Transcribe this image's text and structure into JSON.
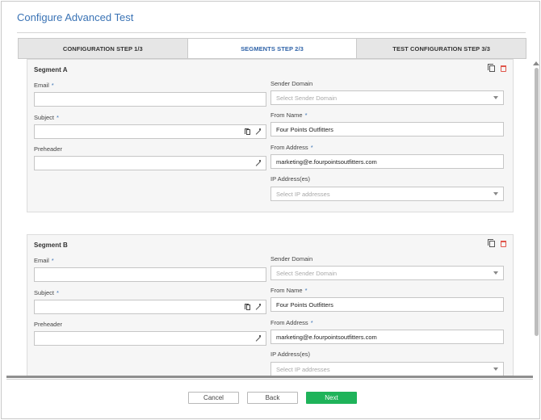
{
  "dialog": {
    "title": "Configure Advanced Test"
  },
  "tabs": [
    {
      "label": "CONFIGURATION STEP 1/3",
      "active": false
    },
    {
      "label": "SEGMENTS STEP 2/3",
      "active": true
    },
    {
      "label": "TEST CONFIGURATION STEP 3/3",
      "active": false
    }
  ],
  "segments": [
    {
      "title": "Segment A",
      "email": {
        "label": "Email",
        "required": "*",
        "value": ""
      },
      "subject": {
        "label": "Subject",
        "required": "*",
        "value": ""
      },
      "preheader": {
        "label": "Preheader",
        "value": ""
      },
      "sender_domain": {
        "label": "Sender Domain",
        "placeholder": "Select Sender Domain"
      },
      "from_name": {
        "label": "From Name",
        "required": "*",
        "value": "Four Points Outfitters"
      },
      "from_address": {
        "label": "From Address",
        "required": "*",
        "value": "marketing@e.fourpointsoutfitters.com"
      },
      "ip_addresses": {
        "label": "IP Address(es)",
        "placeholder": "Select IP addresses"
      }
    },
    {
      "title": "Segment B",
      "email": {
        "label": "Email",
        "required": "*",
        "value": ""
      },
      "subject": {
        "label": "Subject",
        "required": "*",
        "value": ""
      },
      "preheader": {
        "label": "Preheader",
        "value": ""
      },
      "sender_domain": {
        "label": "Sender Domain",
        "placeholder": "Select Sender Domain"
      },
      "from_name": {
        "label": "From Name",
        "required": "*",
        "value": "Four Points Outfitters"
      },
      "from_address": {
        "label": "From Address",
        "required": "*",
        "value": "marketing@e.fourpointsoutfitters.com"
      },
      "ip_addresses": {
        "label": "IP Address(es)",
        "placeholder": "Select IP addresses"
      }
    }
  ],
  "footer": {
    "cancel_label": "Cancel",
    "back_label": "Back",
    "next_label": "Next"
  },
  "colors": {
    "accent": "#3a73b5",
    "primary_button": "#1fb35a",
    "delete_icon": "#e0554a"
  }
}
